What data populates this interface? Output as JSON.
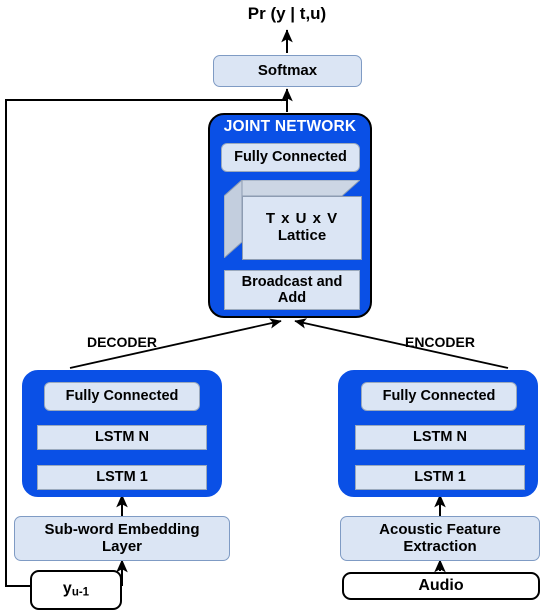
{
  "diagram": {
    "title": "RNN-Transducer architecture",
    "colors": {
      "blue_block": "#0a50e6",
      "pale_slab": "#dbe5f4",
      "slab_border": "#9aa9bd",
      "outline": "#000000",
      "white_node": "#ffffff"
    }
  },
  "output": {
    "probability_label": "Pr (y | t,u)",
    "softmax_label": "Softmax"
  },
  "joint_network": {
    "title": "JOINT NETWORK",
    "fully_connected_label": "Fully Connected",
    "lattice_line1": "T x U x V",
    "lattice_line2": "Lattice",
    "broadcast_line1": "Broadcast and",
    "broadcast_line2": "Add"
  },
  "decoder": {
    "section_label": "DECODER",
    "layers": [
      {
        "label": "Fully Connected"
      },
      {
        "label": "LSTM N"
      },
      {
        "label": "LSTM 1"
      }
    ],
    "input_block_line1": "Sub-word Embedding",
    "input_block_line2": "Layer",
    "source_label_main": "y",
    "source_label_sub": "u-1"
  },
  "encoder": {
    "section_label": "ENCODER",
    "layers": [
      {
        "label": "Fully Connected"
      },
      {
        "label": "LSTM N"
      },
      {
        "label": "LSTM 1"
      }
    ],
    "input_block_line1": "Acoustic Feature",
    "input_block_line2": "Extraction",
    "source_label": "Audio"
  },
  "connections": {
    "feedback_note": "output feeds back to y_{u-1}",
    "decoder_to_joint": "DECODER → JOINT NETWORK",
    "encoder_to_joint": "ENCODER → JOINT NETWORK"
  }
}
